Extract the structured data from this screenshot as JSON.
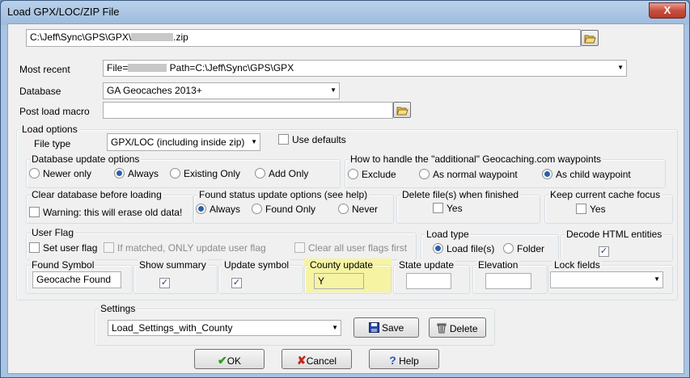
{
  "window": {
    "title": "Load GPX/LOC/ZIP File",
    "close_glyph": "X"
  },
  "file_path": {
    "value": "C:\\Jeff\\Sync\\GPS\\GPX\\",
    "value_suffix": ".zip"
  },
  "most_recent": {
    "label": "Most recent",
    "value_prefix": "File=",
    "value_suffix": " Path=C:\\Jeff\\Sync\\GPS\\GPX"
  },
  "database": {
    "label": "Database",
    "value": "GA Geocaches 2013+"
  },
  "post_load_macro": {
    "label": "Post load macro",
    "value": ""
  },
  "load_options": {
    "legend": "Load options",
    "file_type_label": "File type",
    "file_type_value": "GPX/LOC (including inside zip)",
    "use_defaults": "Use defaults"
  },
  "db_update": {
    "legend": "Database update options",
    "options": [
      "Newer only",
      "Always",
      "Existing Only",
      "Add Only"
    ],
    "selected": "Always"
  },
  "additional_wpts": {
    "legend": "How to handle the \"additional\" Geocaching.com waypoints",
    "options": [
      "Exclude",
      "As normal waypoint",
      "As child waypoint"
    ],
    "selected": "As child waypoint"
  },
  "clear_db": {
    "legend": "Clear database before loading",
    "warning": "Warning: this will erase old data!"
  },
  "found_status": {
    "legend": "Found status update options (see help)",
    "options": [
      "Always",
      "Found Only",
      "Never"
    ],
    "selected": "Always"
  },
  "delete_files": {
    "legend": "Delete file(s) when finished",
    "option": "Yes"
  },
  "keep_focus": {
    "legend": "Keep current cache focus",
    "option": "Yes"
  },
  "user_flag": {
    "legend": "User Flag",
    "set": "Set user flag",
    "if_matched": "If matched, ONLY update user flag",
    "clear_all": "Clear all user flags first"
  },
  "load_type": {
    "legend": "Load type",
    "options": [
      "Load file(s)",
      "Folder"
    ],
    "selected": "Load file(s)"
  },
  "decode_html": {
    "legend": "Decode HTML entities",
    "check": "✓"
  },
  "found_symbol": {
    "legend": "Found Symbol",
    "value": "Geocache Found"
  },
  "show_summary": {
    "legend": "Show summary",
    "check": "✓"
  },
  "update_symbol": {
    "legend": "Update symbol",
    "check": "✓"
  },
  "county_update": {
    "legend": "County update",
    "value": "Y",
    "highlight": "#f6f4a3"
  },
  "state_update": {
    "legend": "State update",
    "value": ""
  },
  "elevation": {
    "legend": "Elevation",
    "value": ""
  },
  "lock_fields": {
    "legend": "Lock fields",
    "value": ""
  },
  "settings": {
    "legend": "Settings",
    "value": "Load_Settings_with_County",
    "save_label": "Save",
    "delete_label": "Delete"
  },
  "buttons": {
    "ok": "OK",
    "cancel": "Cancel",
    "help": "Help"
  },
  "colors": {
    "ok_check": "#2e9a1e",
    "cancel_x": "#c0291d",
    "help_q": "#2a57c0",
    "save_disk": "#2a47a8"
  }
}
